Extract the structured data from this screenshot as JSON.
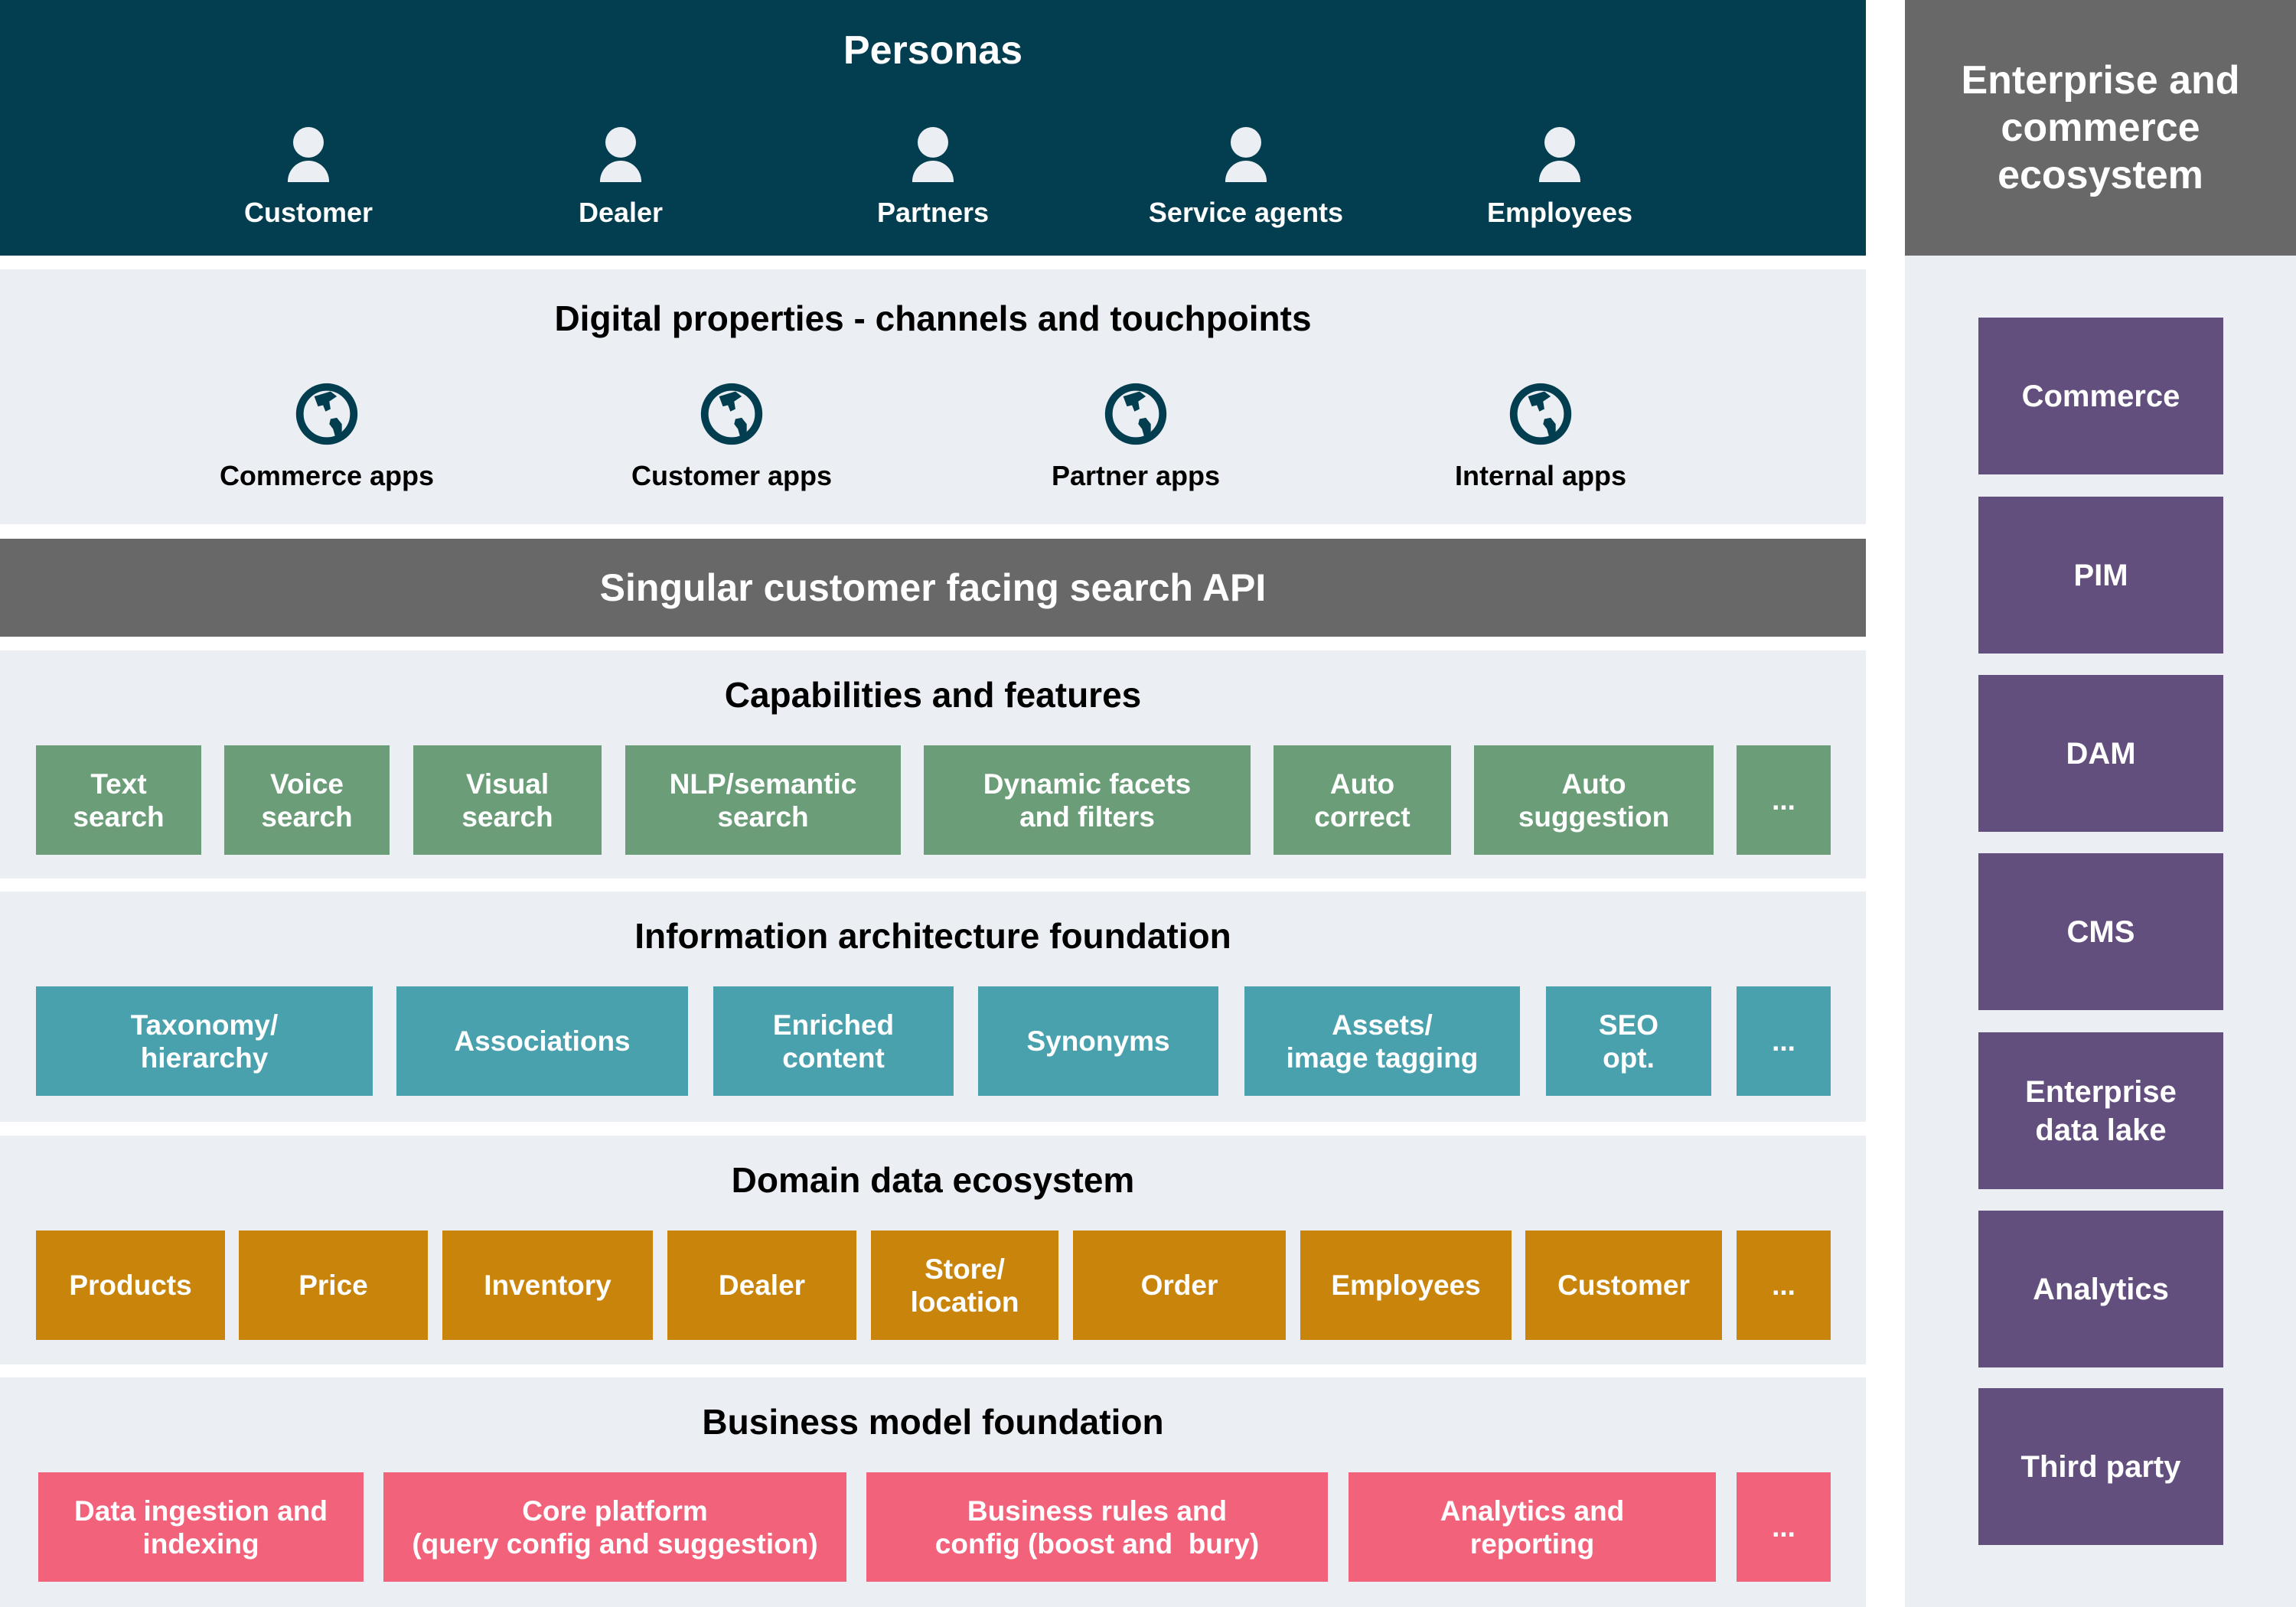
{
  "personas": {
    "title": "Personas",
    "items": [
      {
        "label": "Customer",
        "icon": "person-icon"
      },
      {
        "label": "Dealer",
        "icon": "person-icon"
      },
      {
        "label": "Partners",
        "icon": "person-icon"
      },
      {
        "label": "Service agents",
        "icon": "person-icon"
      },
      {
        "label": "Employees",
        "icon": "person-icon"
      }
    ]
  },
  "digital": {
    "title": "Digital properties - channels and touchpoints",
    "items": [
      {
        "label": "Commerce apps",
        "icon": "globe-icon"
      },
      {
        "label": "Customer apps",
        "icon": "globe-icon"
      },
      {
        "label": "Partner apps",
        "icon": "globe-icon"
      },
      {
        "label": "Internal apps",
        "icon": "globe-icon"
      }
    ]
  },
  "api": {
    "title": "Singular customer facing search API"
  },
  "capabilities": {
    "title": "Capabilities and features",
    "color": "#6b9e78",
    "items": [
      {
        "label": "Text\nsearch"
      },
      {
        "label": "Voice\nsearch"
      },
      {
        "label": "Visual\nsearch"
      },
      {
        "label": "NLP/semantic\nsearch"
      },
      {
        "label": "Dynamic facets\nand filters"
      },
      {
        "label": "Auto\ncorrect"
      },
      {
        "label": "Auto\nsuggestion"
      },
      {
        "label": "..."
      }
    ]
  },
  "information_architecture": {
    "title": "Information architecture foundation",
    "color": "#4aa1ae",
    "items": [
      {
        "label": "Taxonomy/\nhierarchy"
      },
      {
        "label": "Associations"
      },
      {
        "label": "Enriched\ncontent"
      },
      {
        "label": "Synonyms"
      },
      {
        "label": "Assets/\nimage tagging"
      },
      {
        "label": "SEO\nopt."
      },
      {
        "label": "..."
      }
    ]
  },
  "domain_data": {
    "title": "Domain data ecosystem",
    "color": "#c9850b",
    "items": [
      {
        "label": "Products"
      },
      {
        "label": "Price"
      },
      {
        "label": "Inventory"
      },
      {
        "label": "Dealer"
      },
      {
        "label": "Store/\nlocation"
      },
      {
        "label": "Order"
      },
      {
        "label": "Employees"
      },
      {
        "label": "Customer"
      },
      {
        "label": "..."
      }
    ]
  },
  "business_model": {
    "title": "Business model foundation",
    "color": "#f2627b",
    "items": [
      {
        "label": "Data ingestion and\nindexing"
      },
      {
        "label": "Core platform\n(query config and suggestion)"
      },
      {
        "label": "Business rules and\nconfig (boost and  bury)"
      },
      {
        "label": "Analytics and\nreporting"
      },
      {
        "label": "..."
      }
    ]
  },
  "ecosystem": {
    "title": "Enterprise and commerce ecosystem",
    "color": "#624f7d",
    "items": [
      {
        "label": "Commerce"
      },
      {
        "label": "PIM"
      },
      {
        "label": "DAM"
      },
      {
        "label": "CMS"
      },
      {
        "label": "Enterprise\ndata lake"
      },
      {
        "label": "Analytics"
      },
      {
        "label": "Third party"
      }
    ]
  },
  "colors": {
    "personas_bg": "#033d50",
    "band_bg": "#ebeff3",
    "api_bg": "#686868",
    "icon_dark": "#033d50"
  }
}
